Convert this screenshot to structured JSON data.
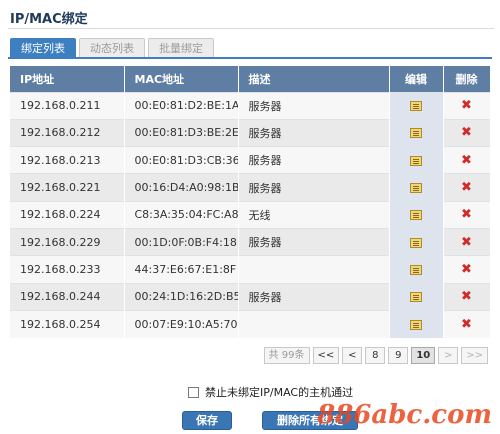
{
  "page": {
    "title": "IP/MAC绑定"
  },
  "tabs": [
    {
      "label": "绑定列表",
      "active": true
    },
    {
      "label": "动态列表",
      "active": false
    },
    {
      "label": "批量绑定",
      "active": false
    }
  ],
  "table": {
    "headers": {
      "ip": "IP地址",
      "mac": "MAC地址",
      "desc": "描述",
      "edit": "编辑",
      "del": "删除"
    },
    "rows": [
      {
        "ip": "192.168.0.211",
        "mac": "00:E0:81:D2:BE:1A",
        "desc": "服务器"
      },
      {
        "ip": "192.168.0.212",
        "mac": "00:E0:81:D3:BE:2E",
        "desc": "服务器"
      },
      {
        "ip": "192.168.0.213",
        "mac": "00:E0:81:D3:CB:36",
        "desc": "服务器"
      },
      {
        "ip": "192.168.0.221",
        "mac": "00:16:D4:A0:98:1B",
        "desc": "服务器"
      },
      {
        "ip": "192.168.0.224",
        "mac": "C8:3A:35:04:FC:A8",
        "desc": "无线"
      },
      {
        "ip": "192.168.0.229",
        "mac": "00:1D:0F:0B:F4:18",
        "desc": "服务器"
      },
      {
        "ip": "192.168.0.233",
        "mac": "44:37:E6:67:E1:8F",
        "desc": ""
      },
      {
        "ip": "192.168.0.244",
        "mac": "00:24:1D:16:2D:B5",
        "desc": "服务器"
      },
      {
        "ip": "192.168.0.254",
        "mac": "00:07:E9:10:A5:70",
        "desc": ""
      }
    ],
    "edit_icon": "edit-icon",
    "delete_icon": "delete-icon",
    "delete_symbol": "✖",
    "delete_color": "#d22a2a"
  },
  "pager": {
    "total": "共 99条",
    "first": "<<",
    "prev": "<",
    "pages": [
      "8",
      "9",
      "10"
    ],
    "current": "10",
    "next": ">",
    "last": ">>"
  },
  "options": {
    "block_unbound_label": "禁止未绑定IP/MAC的主机通过",
    "block_unbound_checked": false
  },
  "buttons": {
    "save": "保存",
    "delete_all": "删除所有绑定"
  },
  "watermark": "886abc.com",
  "colors": {
    "accent": "#3d7fc1",
    "header_bg": "#5e7fa3",
    "button": "#3b76b4"
  }
}
